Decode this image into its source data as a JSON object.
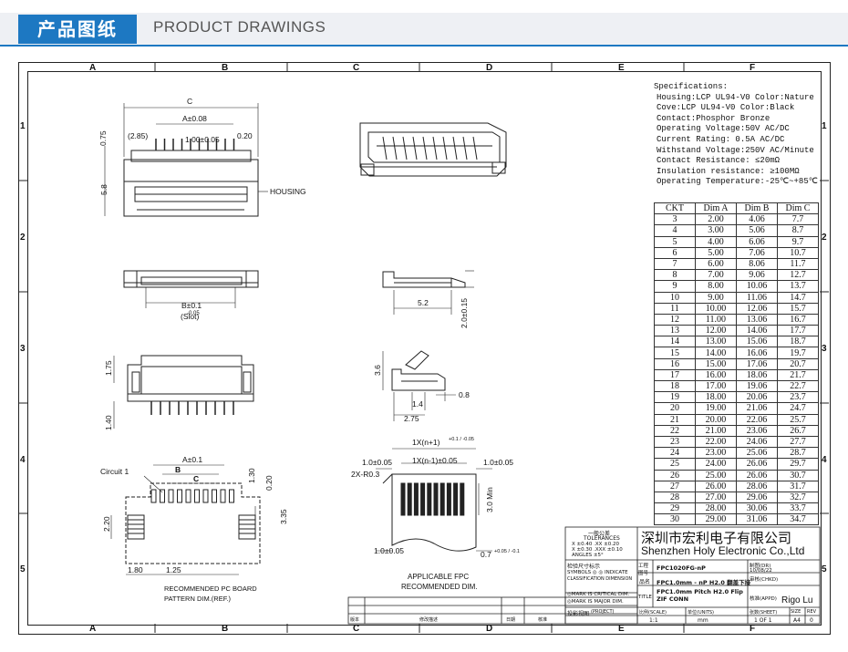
{
  "banner": {
    "title_cn": "产品图纸",
    "title_en": "PRODUCT DRAWINGS"
  },
  "zones": {
    "cols": [
      "A",
      "B",
      "C",
      "D",
      "E",
      "F"
    ],
    "rows": [
      "1",
      "2",
      "3",
      "4",
      "5"
    ]
  },
  "specifications": {
    "heading": "Specifications:",
    "lines": [
      "Housing:LCP UL94-V0 Color:Nature",
      "Cove:LCP UL94-V0 Color:Black",
      "Contact:Phosphor Bronze",
      "Operating Voltage:50V AC/DC",
      "Current Rating: 0.5A AC/DC",
      "Withstand Voltage:250V AC/Minute",
      "Contact Resistance: ≤20mΩ",
      "Insulation resistance: ≥100MΩ",
      "Operating Temperature:-25℃~+85℃"
    ]
  },
  "dim_table": {
    "headers": [
      "CKT",
      "Dim A",
      "Dim B",
      "Dim C"
    ],
    "rows": [
      [
        "3",
        "2.00",
        "4.06",
        "7.7"
      ],
      [
        "4",
        "3.00",
        "5.06",
        "8.7"
      ],
      [
        "5",
        "4.00",
        "6.06",
        "9.7"
      ],
      [
        "6",
        "5.00",
        "7.06",
        "10.7"
      ],
      [
        "7",
        "6.00",
        "8.06",
        "11.7"
      ],
      [
        "8",
        "7.00",
        "9.06",
        "12.7"
      ],
      [
        "9",
        "8.00",
        "10.06",
        "13.7"
      ],
      [
        "10",
        "9.00",
        "11.06",
        "14.7"
      ],
      [
        "11",
        "10.00",
        "12.06",
        "15.7"
      ],
      [
        "12",
        "11.00",
        "13.06",
        "16.7"
      ],
      [
        "13",
        "12.00",
        "14.06",
        "17.7"
      ],
      [
        "14",
        "13.00",
        "15.06",
        "18.7"
      ],
      [
        "15",
        "14.00",
        "16.06",
        "19.7"
      ],
      [
        "16",
        "15.00",
        "17.06",
        "20.7"
      ],
      [
        "17",
        "16.00",
        "18.06",
        "21.7"
      ],
      [
        "18",
        "17.00",
        "19.06",
        "22.7"
      ],
      [
        "19",
        "18.00",
        "20.06",
        "23.7"
      ],
      [
        "20",
        "19.00",
        "21.06",
        "24.7"
      ],
      [
        "21",
        "20.00",
        "22.06",
        "25.7"
      ],
      [
        "22",
        "21.00",
        "23.06",
        "26.7"
      ],
      [
        "23",
        "22.00",
        "24.06",
        "27.7"
      ],
      [
        "24",
        "23.00",
        "25.06",
        "28.7"
      ],
      [
        "25",
        "24.00",
        "26.06",
        "29.7"
      ],
      [
        "26",
        "25.00",
        "26.06",
        "30.7"
      ],
      [
        "27",
        "26.00",
        "28.06",
        "31.7"
      ],
      [
        "28",
        "27.00",
        "29.06",
        "32.7"
      ],
      [
        "29",
        "28.00",
        "30.06",
        "33.7"
      ],
      [
        "30",
        "29.00",
        "31.06",
        "34.7"
      ]
    ]
  },
  "drawing_labels": {
    "c": "C",
    "a008": "A±0.08",
    "p285": "(2.85)",
    "pitch": "1.00±0.05",
    "p020": "0.20",
    "p075": "0.75",
    "p58": "5.8",
    "housing": "HOUSING",
    "b01": "B±0.1",
    "b005": "-0.05",
    "slot": "(Slot)",
    "p52": "5.2",
    "p2015": "2.0±0.15",
    "p175": "1.75",
    "p140": "1.40",
    "p36": "3.6",
    "p14": "1.4",
    "p08": "0.8",
    "p275": "2.75",
    "circuit": "Circuit 1",
    "a01": "A±0.1",
    "b_ref": "B",
    "c_ref": "C",
    "p130": "1.30",
    "p020b": "0.20",
    "p220": "2.20",
    "p335": "3.35",
    "p180": "1.80",
    "p125": "1.25",
    "pcb1": "RECOMMENDED PC BOARD",
    "pcb2": "PATTERN DIM.(REF.)",
    "fpc_n1": "1X(n+1)",
    "fpc_n1_tol": "+0.1 / -0.05",
    "fpc_n": "1X(n-1)±0.05",
    "p10a": "1.0±0.05",
    "p10b": "1.0±0.05",
    "r03": "2X-R0.3",
    "p30": "3.0 Min",
    "p10c": "1.0±0.05",
    "p07": "0.7",
    "p07tol": "+0.05 / -0.1",
    "fpc1": "APPLICABLE FPC",
    "fpc2": "RECOMMENDED DIM."
  },
  "title_block": {
    "company_cn": "深圳市宏利电子有限公司",
    "company_en": "Shenzhen Holy Electronic Co.,Ltd",
    "tol_cn": "一般公差",
    "tol_en": "TOLERANCES",
    "tol_1": "X  ±0.40   .XX  ±0.20",
    "tol_2": "X  ±0.30  .XXX  ±0.10",
    "tol_3": "ANGLES        ±5°",
    "check_cn": "检验尺寸标示",
    "symbols": "SYMBOLS ◎ ◎ INDICATE",
    "class_dim": "CLASSIFICATION DIMENSION",
    "mark1": "◎MARK IS CRITICAL DIM.",
    "mark2": "◎MARK IS MAJOR DIM.",
    "proj_cn": "投影视图",
    "proj_en": "(PROJECT)",
    "drawing_no_lbl": "工程图号",
    "drawing_no": "FPC1020FG-nP",
    "name_lbl": "品名",
    "name": "FPC1.0mm - nP H2.0  翻盖下接",
    "title_lbl": "TITLE",
    "title": "FPC1.0mm Pitch H2.0  Flip ZIF CONN",
    "scale_lbl": "比例(SCALE)",
    "scale": "1:1",
    "unit_lbl": "单位(UNITS)",
    "unit": "mm",
    "drawn_lbl": "制图(DR)",
    "drawn": "10/08/22",
    "checked_lbl": "审核(CHKD)",
    "approved_lbl": "核准(APPD)",
    "approved": "Rigo Lu",
    "sheet_lbl": "张数(SHEET)",
    "sheet": "1  OF  1",
    "size_lbl": "SIZE",
    "size": "A4",
    "rev_lbl": "REV",
    "rev": "0",
    "revision_lbl": "版本",
    "desc_lbl": "修改描述",
    "date_lbl": "日期",
    "approve_lbl": "核准"
  }
}
